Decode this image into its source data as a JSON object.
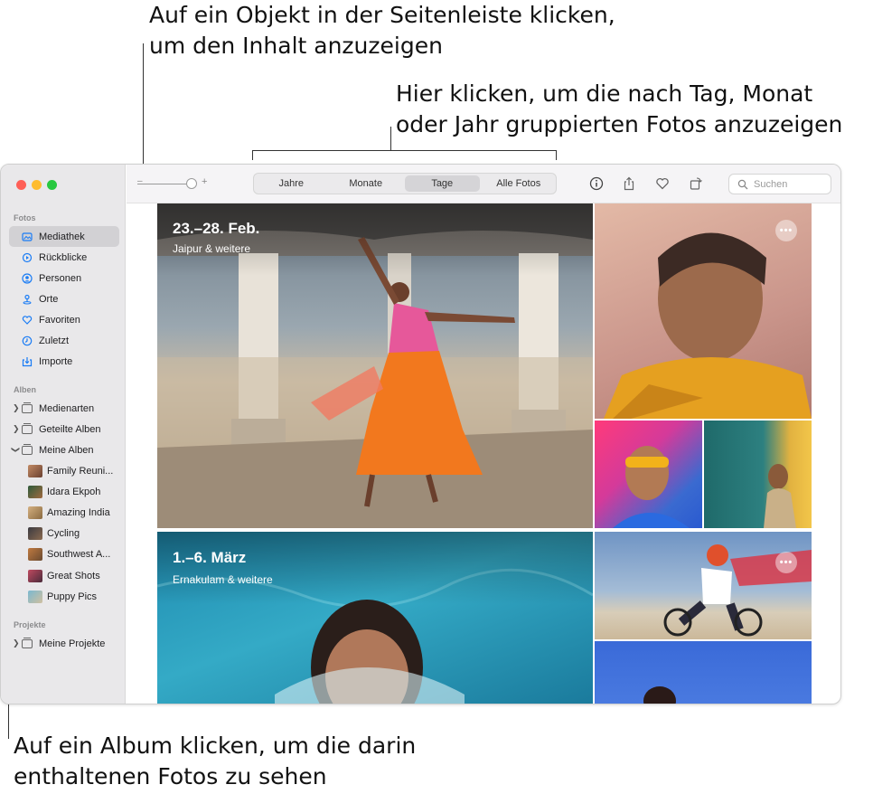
{
  "callouts": {
    "sidebar": [
      "Auf ein Objekt in der Seitenleiste klicken,",
      "um den Inhalt anzuzeigen"
    ],
    "toolbar": [
      "Hier klicken, um die nach Tag, Monat",
      "oder Jahr gruppierten Fotos anzuzeigen"
    ],
    "album": [
      "Auf ein Album klicken, um die darin",
      "enthaltenen Fotos zu sehen"
    ]
  },
  "sidebar": {
    "sections": {
      "fotos": "Fotos",
      "alben": "Alben",
      "projekte": "Projekte"
    },
    "fotos_items": [
      {
        "label": "Mediathek",
        "icon": "library-icon"
      },
      {
        "label": "Rückblicke",
        "icon": "memories-icon"
      },
      {
        "label": "Personen",
        "icon": "people-icon"
      },
      {
        "label": "Orte",
        "icon": "places-icon"
      },
      {
        "label": "Favoriten",
        "icon": "heart-icon"
      },
      {
        "label": "Zuletzt",
        "icon": "clock-icon"
      },
      {
        "label": "Importe",
        "icon": "import-icon"
      }
    ],
    "alben_groups": [
      "Medienarten",
      "Geteilte Alben",
      "Meine Alben"
    ],
    "albums": [
      {
        "label": "Family Reuni...",
        "color": "#8a5a3c"
      },
      {
        "label": "Idara Ekpoh",
        "color": "#4e6a3a"
      },
      {
        "label": "Amazing India",
        "color": "#b08a55"
      },
      {
        "label": "Cycling",
        "color": "#5a4a3a"
      },
      {
        "label": "Southwest A...",
        "color": "#9b6a40"
      },
      {
        "label": "Great Shots",
        "color": "#7a3a4a"
      },
      {
        "label": "Puppy Pics",
        "color": "#6a9ab0"
      }
    ],
    "projekte_group": "Meine Projekte"
  },
  "toolbar": {
    "zoom_minus": "–",
    "zoom_plus": "+",
    "segments": [
      "Jahre",
      "Monate",
      "Tage",
      "Alle Fotos"
    ],
    "selected_segment": "Tage",
    "search_placeholder": "Suchen"
  },
  "moments": [
    {
      "title": "23.–28. Feb.",
      "subtitle": "Jaipur & weitere"
    },
    {
      "title": "1.–6. März",
      "subtitle": "Ernakulam & weitere"
    }
  ],
  "more_label": "•••",
  "colors": {
    "accent": "#1a7cf5",
    "sidebar_bg": "#e9e8ea",
    "traffic_red": "#fe5f57",
    "traffic_yellow": "#febc2e",
    "traffic_green": "#28c840"
  }
}
